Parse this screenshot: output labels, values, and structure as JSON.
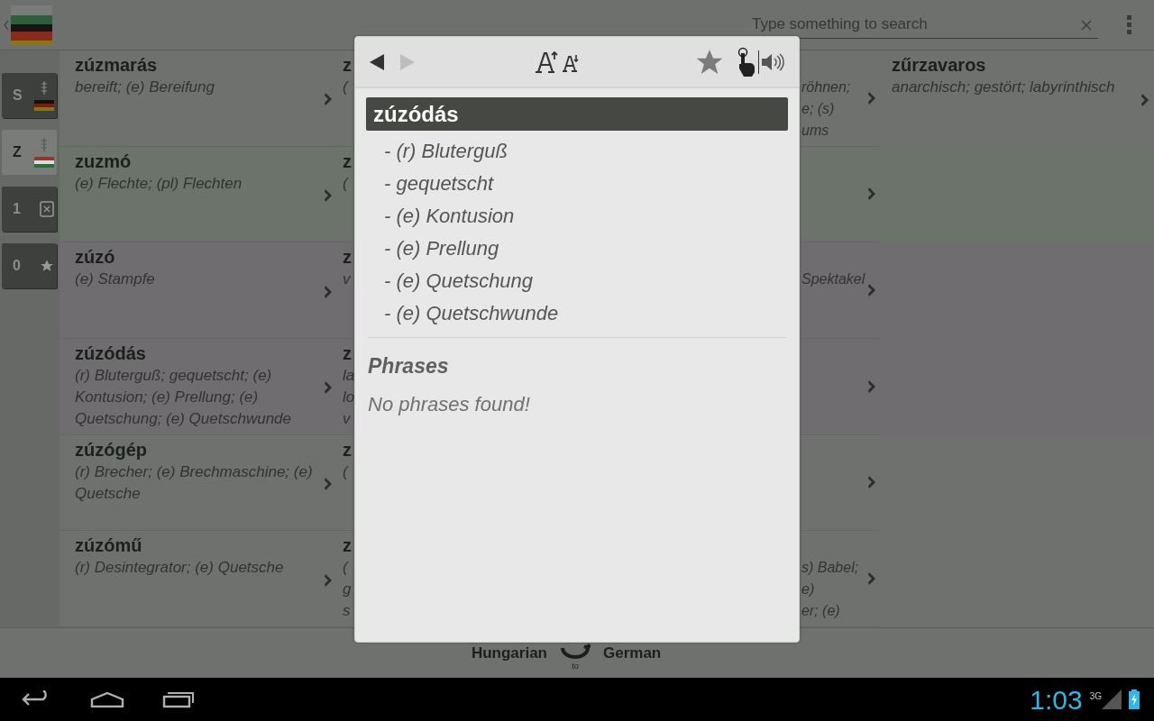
{
  "top_bar": {
    "search": {
      "placeholder": "Type something to search"
    }
  },
  "sidebar": {
    "tabs": [
      {
        "label": "S",
        "kind": "german",
        "selected": false
      },
      {
        "label": "Z",
        "kind": "hungarian",
        "selected": true
      },
      {
        "label": "1",
        "kind": "numbers",
        "selected": false
      },
      {
        "label": "0",
        "kind": "favorites",
        "selected": false
      }
    ]
  },
  "rows": [
    {
      "column_1": {
        "word": "zúzmarás",
        "definition": "bereift; (e) Bereifung"
      },
      "column_2": {
        "left": [
          "z",
          "("
        ],
        "right": [
          "röhnen;",
          "e; (s)",
          "ums"
        ]
      },
      "column_3": {
        "word": "zűrzavaros",
        "definition": "anarchisch; gestört; labyrinthisch"
      }
    },
    {
      "column_1": {
        "word": "zuzmó",
        "definition": "(e) Flechte; (pl) Flechten"
      },
      "column_2": {
        "left": [
          "z",
          "("
        ]
      }
    },
    {
      "column_1": {
        "word": "zúzó",
        "definition": "(e) Stampfe"
      },
      "column_2": {
        "left": [
          "z",
          "v"
        ],
        "right": [
          "Spektakel"
        ]
      }
    },
    {
      "column_1": {
        "word": "zúzódás",
        "definition": "(r) Bluterguß; gequetscht; (e) Kontusion; (e) Prellung; (e) Quetschung; (e) Quetschwunde"
      },
      "column_2": {
        "left": [
          "z",
          "la",
          "lo",
          "v"
        ]
      }
    },
    {
      "column_1": {
        "word": "zúzógép",
        "definition": "(r) Brecher; (e) Brechmaschine; (e) Quetsche"
      },
      "column_2": {
        "left": [
          "z",
          "("
        ]
      }
    },
    {
      "column_1": {
        "word": "zúzómű",
        "definition": "(r) Desintegrator; (e) Quetsche"
      },
      "column_2": {
        "left": [
          "z",
          "(",
          "g",
          "s"
        ],
        "right": [
          "s) Babel;",
          "e)",
          "er; (e)"
        ]
      }
    }
  ],
  "bottom_bar": {
    "from": "Hungarian",
    "swap_label": "to",
    "to": "German"
  },
  "dialog": {
    "toolbar": {
      "back_disabled": false,
      "forward_disabled": true,
      "starred": false
    },
    "headword": "zúzódás",
    "translations": [
      "- (r) Bluterguß",
      "- gequetscht",
      "- (e) Kontusion",
      "- (e) Prellung",
      "- (e) Quetschung",
      "- (e) Quetschwunde"
    ],
    "phrases_title": "Phrases",
    "phrases_empty": "No phrases found!"
  },
  "status_bar": {
    "time": "1:03",
    "network": "3G"
  }
}
